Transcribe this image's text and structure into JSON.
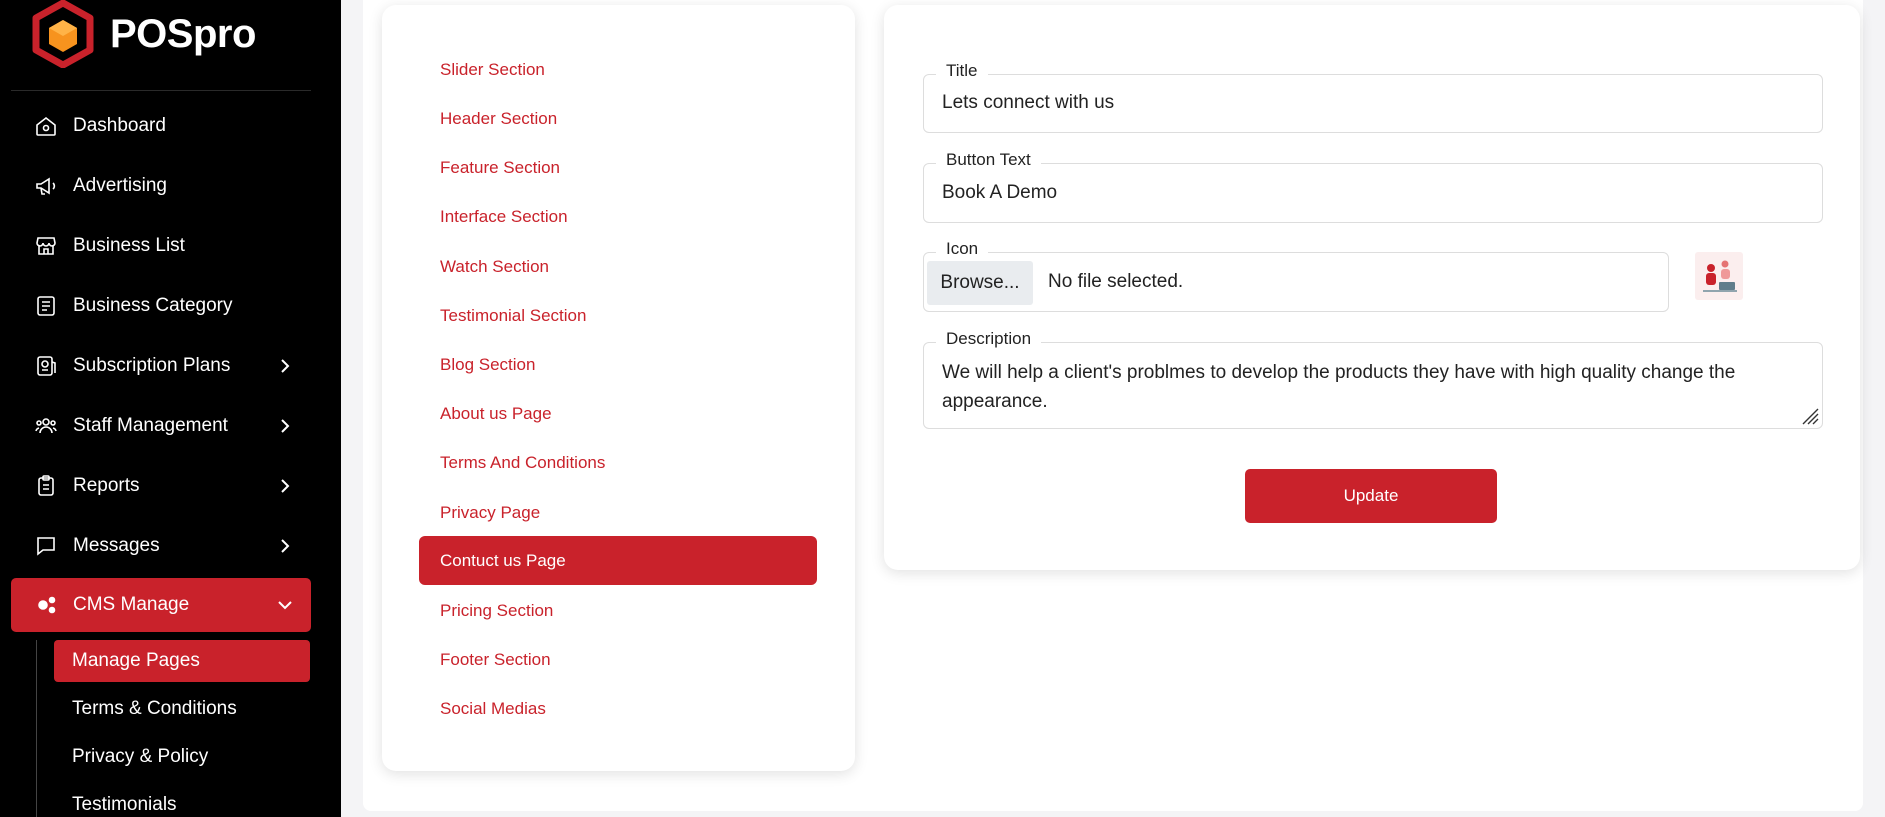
{
  "app": {
    "name": "POSpro"
  },
  "colors": {
    "brand": "#c9222b",
    "sidebar_bg": "#000000",
    "logo_orange": "#f7931e"
  },
  "sidebar": {
    "items": [
      {
        "label": "Dashboard",
        "icon": "home-icon",
        "has_chevron": false
      },
      {
        "label": "Advertising",
        "icon": "megaphone-icon",
        "has_chevron": false
      },
      {
        "label": "Business List",
        "icon": "store-icon",
        "has_chevron": false
      },
      {
        "label": "Business Category",
        "icon": "list-icon",
        "has_chevron": false
      },
      {
        "label": "Subscription Plans",
        "icon": "badge-icon",
        "has_chevron": true
      },
      {
        "label": "Staff Management",
        "icon": "users-icon",
        "has_chevron": true
      },
      {
        "label": "Reports",
        "icon": "clipboard-icon",
        "has_chevron": true
      },
      {
        "label": "Messages",
        "icon": "message-icon",
        "has_chevron": true
      },
      {
        "label": "CMS Manage",
        "icon": "gears-icon",
        "has_chevron": true,
        "expanded": true,
        "active": true
      }
    ],
    "cms_sub_items": [
      {
        "label": "Manage Pages",
        "active": true
      },
      {
        "label": "Terms & Conditions"
      },
      {
        "label": "Privacy & Policy"
      },
      {
        "label": "Testimonials"
      }
    ]
  },
  "pages": {
    "items": [
      "Slider Section",
      "Header Section",
      "Feature Section",
      "Interface Section",
      "Watch Section",
      "Testimonial Section",
      "Blog Section",
      "About us Page",
      "Terms And Conditions",
      "Privacy Page",
      "Contuct us Page",
      "Pricing Section",
      "Footer Section",
      "Social Medias"
    ],
    "active": "Contuct us Page"
  },
  "form": {
    "title_label": "Title",
    "title_value": "Lets connect with us",
    "button_text_label": "Button Text",
    "button_text_value": "Book A Demo",
    "icon_label": "Icon",
    "browse_label": "Browse...",
    "file_status": "No file selected.",
    "description_label": "Description",
    "description_value": "We will help a client's problmes to develop the products they have with high quality change the appearance.",
    "update_label": "Update"
  }
}
